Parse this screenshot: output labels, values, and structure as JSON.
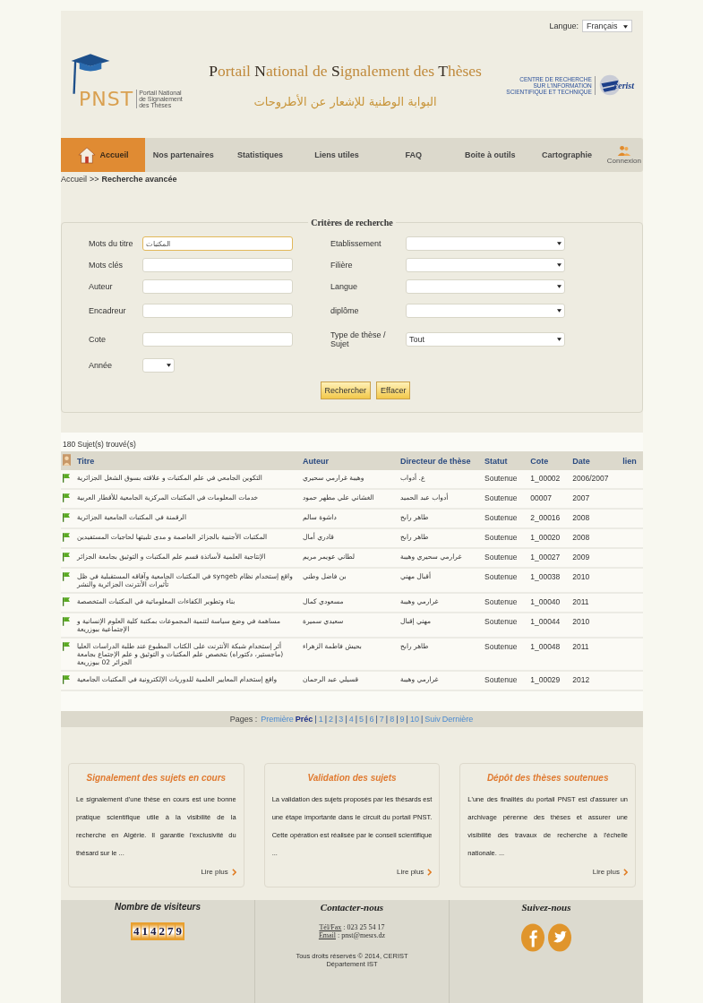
{
  "language": {
    "label": "Langue:",
    "value": "Français"
  },
  "header": {
    "logo": {
      "acronym": "PNST",
      "lines": [
        "Portail National",
        "de Signalement",
        "des Thèses"
      ]
    },
    "title": "Portail National de Signalement des Thèses",
    "arabic_title": "البوابة الوطنية للإشعار عن الأطروحات",
    "cerist": {
      "lines": [
        "CENTRE DE RECHERCHE",
        "SUR L'INFORMATION",
        "SCIENTIFIQUE ET TECHNIQUE"
      ],
      "name": "cerist"
    }
  },
  "nav": [
    {
      "label": "Accueil",
      "selected": true,
      "kind": "home"
    },
    {
      "label": "Nos partenaires",
      "selected": false,
      "kind": "plain"
    },
    {
      "label": "Statistiques",
      "selected": false,
      "kind": "plain"
    },
    {
      "label": "Liens utiles",
      "selected": false,
      "kind": "plain"
    },
    {
      "label": "FAQ",
      "selected": false,
      "kind": "plain"
    },
    {
      "label": "Boite à outils",
      "selected": false,
      "kind": "plain"
    },
    {
      "label": "Cartographie",
      "selected": false,
      "kind": "plain"
    },
    {
      "label": "Connexion",
      "selected": false,
      "kind": "user"
    }
  ],
  "breadcrumb": {
    "items": [
      "Accueil",
      "Recherche avancée"
    ],
    "separator": ">>"
  },
  "form": {
    "legend": "Critères de recherche",
    "left": [
      {
        "label": "Mots du titre",
        "kind": "text",
        "value": "المكتبات"
      },
      {
        "label": "Mots clés",
        "kind": "text"
      },
      {
        "label": "Auteur",
        "kind": "text"
      },
      {
        "label": "Encadreur",
        "kind": "text"
      },
      {
        "label": "Cote",
        "kind": "text"
      },
      {
        "label": "Année",
        "kind": "small-select"
      }
    ],
    "right": [
      {
        "label": "Etablissement",
        "kind": "select"
      },
      {
        "label": "Filière",
        "kind": "select"
      },
      {
        "label": "Langue",
        "kind": "select"
      },
      {
        "label": "diplôme",
        "kind": "select"
      },
      {
        "label": "Type de thèse / Sujet",
        "kind": "select",
        "value": "Tout"
      }
    ],
    "buttons": [
      "Rechercher",
      "Effacer"
    ]
  },
  "results": {
    "count": "180 Sujet(s) trouvé(s)",
    "columns": [
      "Titre",
      "Auteur",
      "Directeur de thèse",
      "Statut",
      "Cote",
      "Date",
      "lien"
    ],
    "rows": [
      {
        "title": "التكوين الجامعي في علم المكتبات و علاقته بسوق الشغل الجزائرية",
        "author": "وهيبة غرارمي سحيري",
        "director": "ع. أدواب",
        "status": "Soutenue",
        "cote": "1_00002",
        "date": "2006/2007"
      },
      {
        "title": "خدمات المعلومات في المكتبات المركزية الجامعية للأقطار العربية",
        "author": "الغشاني علي مطهر حمود",
        "director": "أدواب عبد الحميد",
        "status": "Soutenue",
        "cote": "00007",
        "date": "2007"
      },
      {
        "title": "الرقمنة في المكتبات الجامعية الجزائرية",
        "author": "داشوة سالم",
        "director": "طاهر رابح",
        "status": "Soutenue",
        "cote": "2_00016",
        "date": "2008"
      },
      {
        "title": "المكتبات الأجنبية بالجزائر العاصمة و مدى تلبيتها لحاجيات المستفيدين",
        "author": "قادري أمال",
        "director": "طاهر رابح",
        "status": "Soutenue",
        "cote": "1_00020",
        "date": "2008"
      },
      {
        "title": "الإنتاجية العلمية لأساتذة قسم علم المكتبات و التوثيق بجامعة الجزائر",
        "author": "لطاني عويمر مريم",
        "director": "غرارمي سحيري وهيبة",
        "status": "Soutenue",
        "cote": "1_00027",
        "date": "2009"
      },
      {
        "title": "واقع إستخدام نظام syngeb في المكتبات الجامعية وآفاقه المستقبلية في ظل تأثيرات الأنترنت الجزائرية والنشر",
        "author": "بن فاضل وطني",
        "director": "أقبال مهني",
        "status": "Soutenue",
        "cote": "1_00038",
        "date": "2010"
      },
      {
        "title": "بناء وتطوير الكفاءات المعلوماتية في المكتبات المتخصصة",
        "author": "مسعودي كمال",
        "director": "غرارمي وهيبة",
        "status": "Soutenue",
        "cote": "1_00040",
        "date": "2011"
      },
      {
        "title": "مساهمة في وضع سياسة لتنمية المجموعات بمكتبة كلية العلوم الإنسانية و الإجتماعية ببوزريعة",
        "author": "سعيدي سميرة",
        "director": "مهني إقبال",
        "status": "Soutenue",
        "cote": "1_00044",
        "date": "2010"
      },
      {
        "title": "أثر إستخدام شبكة الأنترنت على الكتاب المطبوع عند طلبة الدراسات العليا (ماجستير، دكتوراه) بتخصص علم المكتبات و التوثيق و علم الإجتماع بجامعة الجزائر 02 ببوزريعة",
        "author": "بحيش فاطمة الزهراء",
        "director": "طاهر رابح",
        "status": "Soutenue",
        "cote": "1_00048",
        "date": "2011"
      },
      {
        "title": "واقع إستخدام المعايير العلمية للدوريات الإلكترونية في المكتبات الجامعية",
        "author": "قسيلي عبد الرحمان",
        "director": "غرارمي وهيبة",
        "status": "Soutenue",
        "cote": "1_00029",
        "date": "2012"
      }
    ],
    "pagination": {
      "label": "Pages :",
      "separator": "|",
      "links": [
        {
          "text": "Première",
          "highlighted": false
        },
        {
          "text": "Préc",
          "highlighted": true
        },
        {
          "text": "1",
          "highlighted": false
        },
        {
          "text": "2",
          "highlighted": false
        },
        {
          "text": "3",
          "highlighted": false
        },
        {
          "text": "4",
          "highlighted": false
        },
        {
          "text": "5",
          "highlighted": false
        },
        {
          "text": "6",
          "highlighted": false
        },
        {
          "text": "7",
          "highlighted": false
        },
        {
          "text": "8",
          "highlighted": false
        },
        {
          "text": "9",
          "highlighted": false
        },
        {
          "text": "10",
          "highlighted": false
        },
        {
          "text": "Suiv",
          "highlighted": false
        },
        {
          "text": "Dernière",
          "highlighted": false
        }
      ]
    }
  },
  "cards": [
    {
      "title": "Signalement des sujets en cours",
      "text": "Le signalement d'une thèse en cours est une bonne pratique scientifique utile à la visibilité de la recherche en Algérie. Il garantie l'exclusivité du thésard sur le ...",
      "link": "Lire plus"
    },
    {
      "title": "Validation des sujets",
      "text": "La validation des sujets proposés par les thésards est une étape importante dans le circuit du portail PNST. Cette opération est réalisée par le conseil scientifique ...",
      "link": "Lire plus"
    },
    {
      "title": "Dépôt des thèses soutenues",
      "text": "L'une des finalités du portail PNST est d'assurer un archivage pérenne des thèses et assurer une visibilité des travaux de recherche à l'échelle nationale. ...",
      "link": "Lire plus"
    }
  ],
  "footer": {
    "visitors": {
      "title": "Nombre de visiteurs",
      "digits": "414279"
    },
    "contact": {
      "title": "Contacter-nous",
      "phone_label": "Tél/Fax",
      "phone": ": 023 25 54 17",
      "email_label": "Email",
      "email": ": pnst@mesrs.dz",
      "copyright": "Tous droits réservés © 2014, CERIST",
      "department": "Département IST"
    },
    "social": {
      "title": "Suivez-nous",
      "networks": [
        {
          "kind": "facebook"
        },
        {
          "kind": "twitter"
        }
      ]
    }
  }
}
